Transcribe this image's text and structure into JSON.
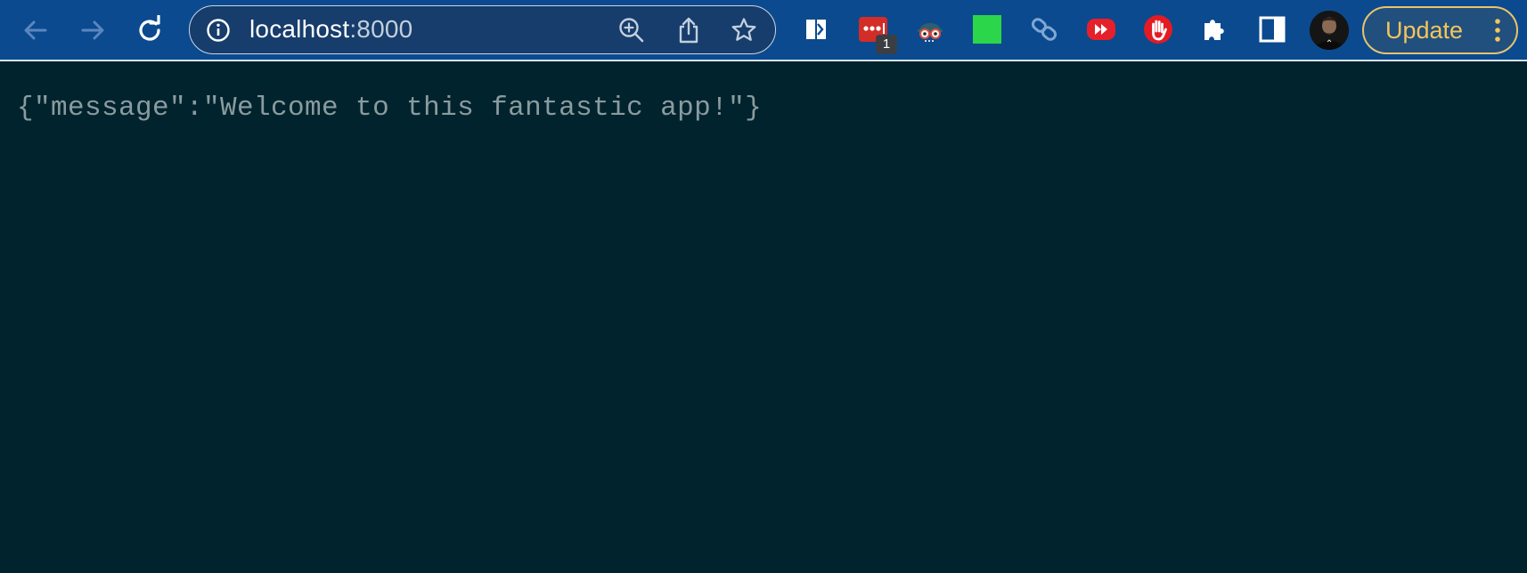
{
  "toolbar": {
    "back_icon": "arrow-left-icon",
    "forward_icon": "arrow-right-icon",
    "reload_icon": "reload-icon",
    "address_bar": {
      "info_icon": "info-icon",
      "host": "localhost",
      "port": ":8000",
      "zoom_icon": "zoom-icon",
      "share_icon": "share-icon",
      "bookmark_icon": "star-icon"
    },
    "extensions": [
      {
        "name": "reader-extension-icon"
      },
      {
        "name": "lastpass-extension-icon",
        "badge": "1"
      },
      {
        "name": "spy-extension-icon"
      },
      {
        "name": "green-square-extension-icon"
      },
      {
        "name": "link-extension-icon"
      },
      {
        "name": "video-speed-extension-icon"
      },
      {
        "name": "hand-stop-extension-icon"
      },
      {
        "name": "puzzle-extensions-icon"
      },
      {
        "name": "side-panel-icon"
      }
    ],
    "update_label": "Update",
    "menu_icon": "kebab-menu-icon"
  },
  "page": {
    "body_text": "{\"message\":\"Welcome to this fantastic app!\"}"
  },
  "colors": {
    "toolbar_bg": "#0b4a8f",
    "page_bg": "#00232d",
    "page_text": "#8a9b9f",
    "update_accent": "#f4c55b"
  }
}
